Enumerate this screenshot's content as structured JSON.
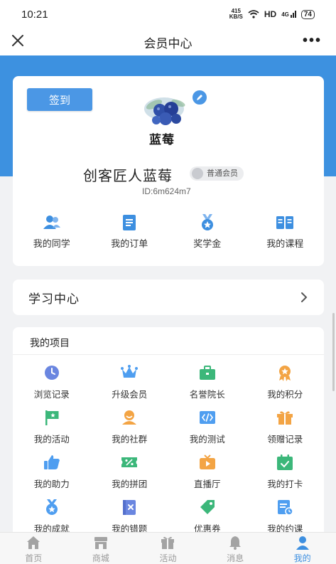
{
  "status_bar": {
    "time": "10:21",
    "speed_value": "415",
    "speed_unit": "KB/S",
    "hd": "HD",
    "network": "4G",
    "battery": "74"
  },
  "nav": {
    "title": "会员中心"
  },
  "profile": {
    "signin_label": "签到",
    "avatar_text": "蓝莓",
    "username": "创客匠人蓝莓",
    "member_level": "普通会员",
    "user_id": "ID:6m624m7"
  },
  "quick_actions": [
    {
      "label": "我的同学",
      "icon": "classmates-icon"
    },
    {
      "label": "我的订单",
      "icon": "orders-icon"
    },
    {
      "label": "奖学金",
      "icon": "medal-icon"
    },
    {
      "label": "我的课程",
      "icon": "course-book-icon"
    }
  ],
  "study_center": {
    "title": "学习中心"
  },
  "projects": {
    "title": "我的项目",
    "items": [
      {
        "label": "浏览记录",
        "icon": "clock-icon",
        "color": "#6a86e0"
      },
      {
        "label": "升级会员",
        "icon": "crown-icon",
        "color": "#4f9ef0"
      },
      {
        "label": "名誉院长",
        "icon": "briefcase-icon",
        "color": "#3cb77a"
      },
      {
        "label": "我的积分",
        "icon": "badge-star-icon",
        "color": "#f3a444"
      },
      {
        "label": "我的活动",
        "icon": "flag-icon",
        "color": "#3cb77a"
      },
      {
        "label": "我的社群",
        "icon": "group-icon",
        "color": "#f3a444"
      },
      {
        "label": "我的测试",
        "icon": "code-icon",
        "color": "#4f9ef0"
      },
      {
        "label": "领赠记录",
        "icon": "gift-icon",
        "color": "#f3a444"
      },
      {
        "label": "我的助力",
        "icon": "thumb-up-icon",
        "color": "#4f9ef0"
      },
      {
        "label": "我的拼团",
        "icon": "discount-ticket-icon",
        "color": "#3cb77a"
      },
      {
        "label": "直播厅",
        "icon": "live-play-icon",
        "color": "#f3a444"
      },
      {
        "label": "我的打卡",
        "icon": "calendar-check-icon",
        "color": "#3cb77a"
      },
      {
        "label": "我的成就",
        "icon": "achievement-medal-icon",
        "color": "#4f9ef0"
      },
      {
        "label": "我的错题",
        "icon": "wrong-answer-book-icon",
        "color": "#6a86e0"
      },
      {
        "label": "优惠券",
        "icon": "coupon-tag-icon",
        "color": "#3cb77a"
      },
      {
        "label": "我的约课",
        "icon": "appointment-doc-icon",
        "color": "#4f9ef0"
      }
    ]
  },
  "tabbar": [
    {
      "label": "首页",
      "icon": "home-icon",
      "active": false
    },
    {
      "label": "商城",
      "icon": "store-icon",
      "active": false
    },
    {
      "label": "活动",
      "icon": "gift-box-icon",
      "active": false
    },
    {
      "label": "消息",
      "icon": "bell-icon",
      "active": false
    },
    {
      "label": "我的",
      "icon": "person-icon",
      "active": true
    }
  ],
  "colors": {
    "brand_blue": "#3d91e0",
    "active_tab": "#3d8fe0",
    "inactive_tab": "#999999"
  }
}
